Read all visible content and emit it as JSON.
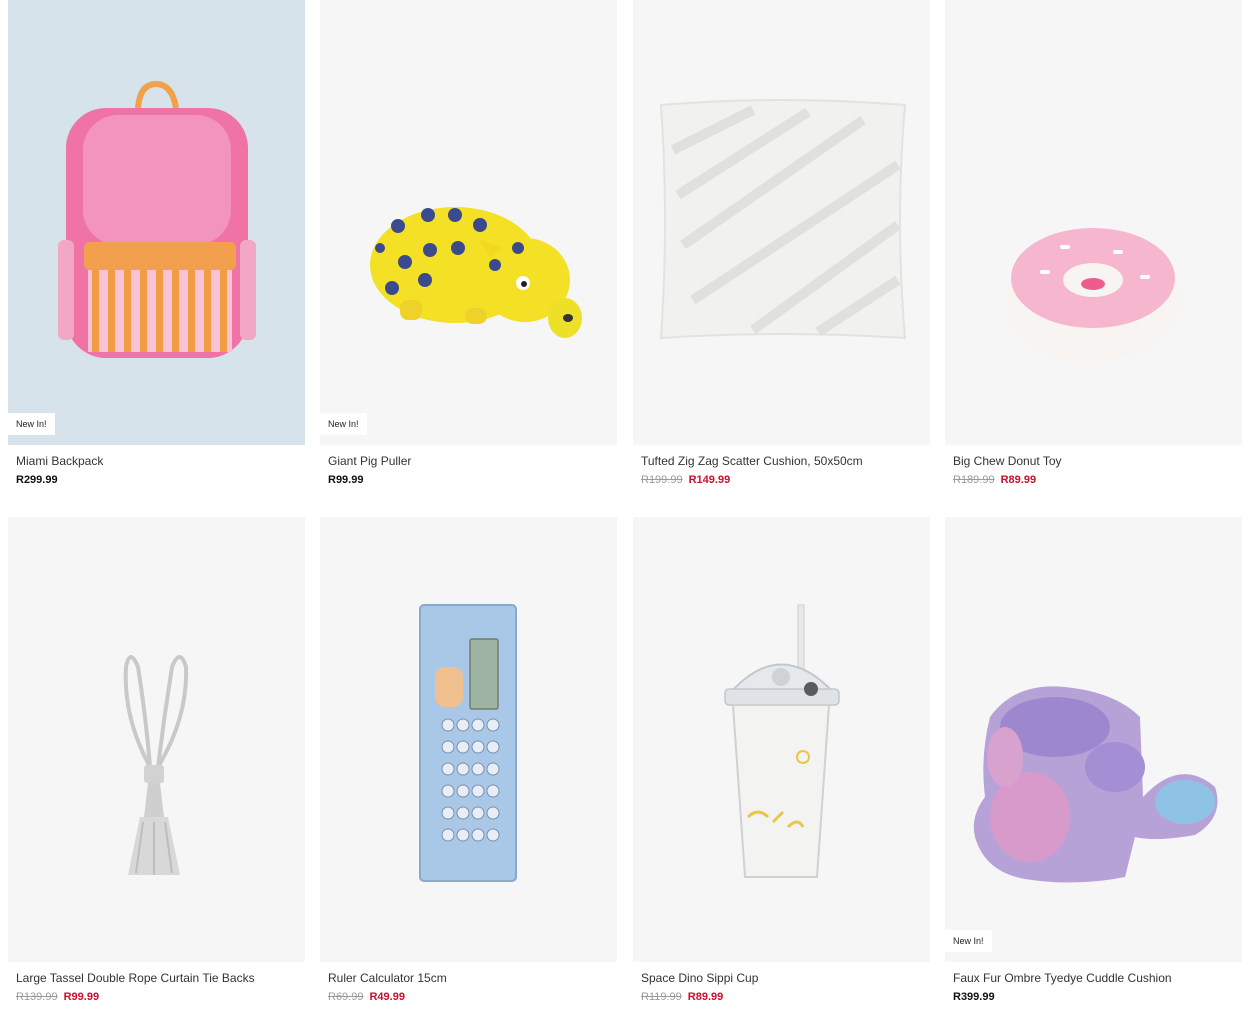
{
  "products": [
    {
      "name": "Miami Backpack",
      "badge": "New In!",
      "price": "R299.99"
    },
    {
      "name": "Giant Pig Puller",
      "badge": "New In!",
      "price": "R99.99"
    },
    {
      "name": "Tufted Zig Zag Scatter Cushion, 50x50cm",
      "was": "R199.99",
      "now": "R149.99"
    },
    {
      "name": "Big Chew Donut Toy",
      "was": "R189.99",
      "now": "R89.99"
    },
    {
      "name": "Large Tassel Double Rope Curtain Tie Backs",
      "was": "R139.99",
      "now": "R99.99"
    },
    {
      "name": "Ruler Calculator 15cm",
      "was": "R69.99",
      "now": "R49.99"
    },
    {
      "name": "Space Dino Sippi Cup",
      "was": "R119.99",
      "now": "R89.99"
    },
    {
      "name": "Faux Fur Ombre Tyedye Cuddle Cushion",
      "badge": "New In!",
      "price": "R399.99"
    }
  ],
  "colors": {
    "sale": "#c8102e",
    "was": "#9a9a9a",
    "image_bg": "#f6f6f6"
  }
}
